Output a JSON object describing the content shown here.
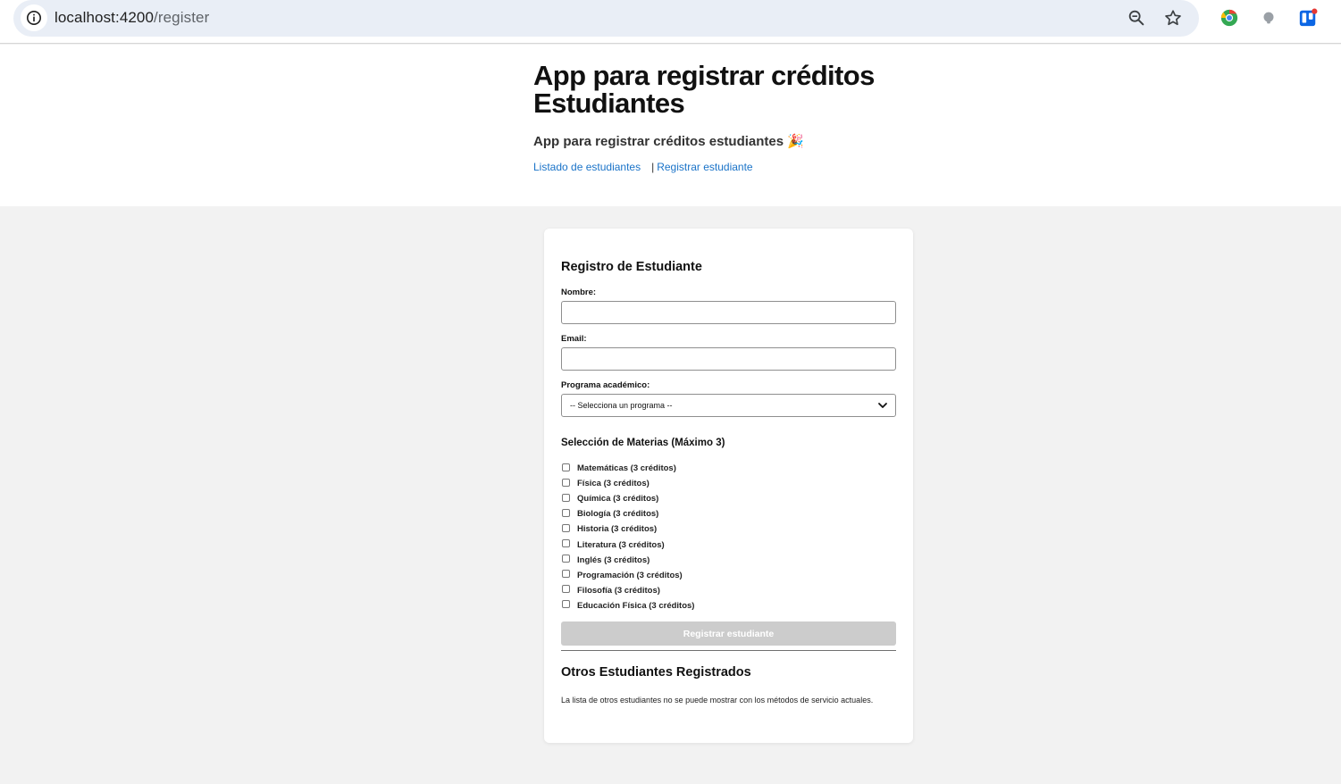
{
  "browser": {
    "url_host": "localhost:4200",
    "url_path": "/register",
    "icons": [
      "info-icon",
      "zoom-icon",
      "bookmark-star-icon",
      "extension-chrome-icon",
      "extension-gray-icon",
      "extension-trello-icon"
    ]
  },
  "header": {
    "title": "App para registrar créditos Estudiantes",
    "subtitle": "App para registrar créditos estudiantes 🎉",
    "nav": {
      "list_link": "Listado de estudiantes",
      "separator": "|",
      "register_link": "Registrar estudiante"
    }
  },
  "form": {
    "title": "Registro de Estudiante",
    "name_label": "Nombre:",
    "name_value": "",
    "email_label": "Email:",
    "email_value": "",
    "program_label": "Programa académico:",
    "program_selected": "-- Selecciona un programa --",
    "subjects_title": "Selección de Materias (Máximo 3)",
    "subjects": [
      {
        "label": "Matemáticas (3 créditos)",
        "checked": false
      },
      {
        "label": "Física (3 créditos)",
        "checked": false
      },
      {
        "label": "Química (3 créditos)",
        "checked": false
      },
      {
        "label": "Biología (3 créditos)",
        "checked": false
      },
      {
        "label": "Historia (3 créditos)",
        "checked": false
      },
      {
        "label": "Literatura (3 créditos)",
        "checked": false
      },
      {
        "label": "Inglés (3 créditos)",
        "checked": false
      },
      {
        "label": "Programación (3 créditos)",
        "checked": false
      },
      {
        "label": "Filosofía (3 créditos)",
        "checked": false
      },
      {
        "label": "Educación Física (3 créditos)",
        "checked": false
      }
    ],
    "submit_label": "Registrar estudiante",
    "submit_disabled": true
  },
  "others": {
    "title": "Otros Estudiantes Registrados",
    "note": "La lista de otros estudiantes no se puede mostrar con los métodos de servicio actuales."
  },
  "colors": {
    "link": "#1a73c8",
    "page_bg": "#f2f2f2",
    "button_disabled": "#cccccc",
    "omnibox": "#e9eef6"
  }
}
